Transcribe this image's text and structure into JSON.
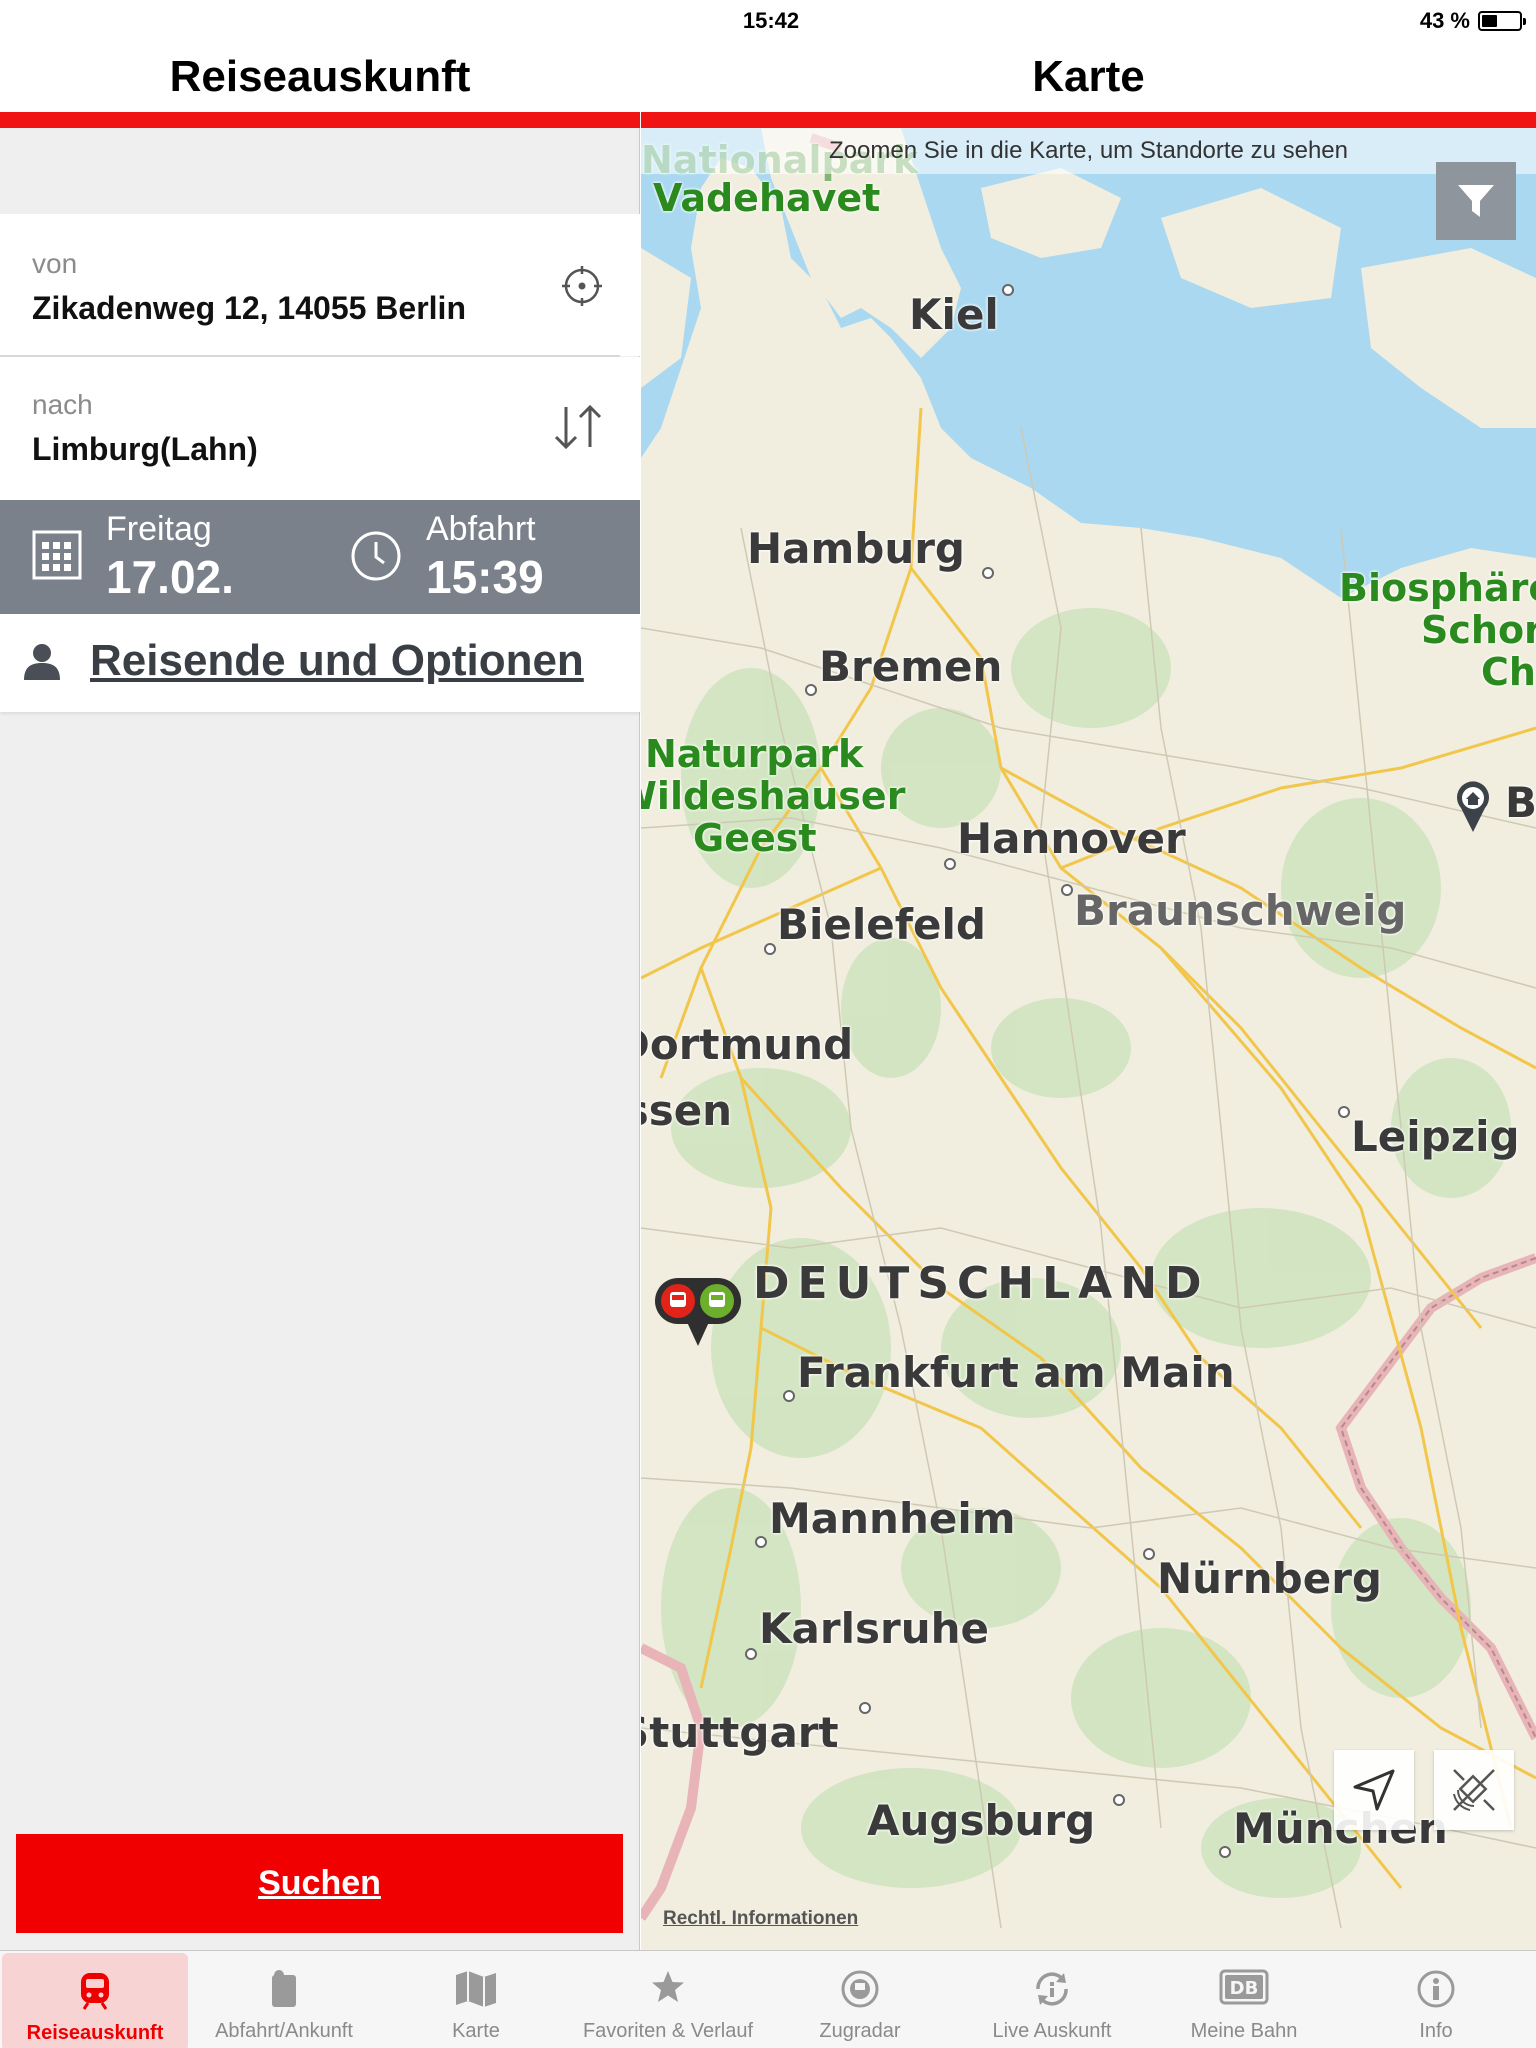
{
  "status": {
    "device": "iPad",
    "time": "15:42",
    "battery": "43 %",
    "battery_level": 0.43
  },
  "left": {
    "title": "Reiseauskunft",
    "from": {
      "label": "von",
      "value": "Zikadenweg 12, 14055 Berlin"
    },
    "to": {
      "label": "nach",
      "value": "Limburg(Lahn)"
    },
    "date": {
      "day": "Freitag",
      "value": "17.02."
    },
    "time": {
      "label": "Abfahrt",
      "value": "15:39"
    },
    "options": "Reisende und Optionen",
    "search": "Suchen"
  },
  "right": {
    "title": "Karte",
    "hint": "Zoomen Sie in die Karte, um Standorte zu sehen",
    "legal": "Rechtl. Informationen",
    "labels": {
      "nationalpark": "Nationalpark",
      "vadehavet": "Vadehavet",
      "kiel": "Kiel",
      "hamburg": "Hamburg",
      "bremen": "Bremen",
      "naturpark1": "Naturpark",
      "naturpark2": "Wildeshauser",
      "naturpark3": "Geest",
      "hannover": "Hannover",
      "braunschweig": "Braunschweig",
      "bielefeld": "Bielefeld",
      "dortmund": "Dortmund",
      "essen": "Essen",
      "leipzig": "Leipzig",
      "deutschland": "DEUTSCHLAND",
      "frankfurt": "Frankfurt am Main",
      "mannheim": "Mannheim",
      "nuernberg": "Nürnberg",
      "karlsruhe": "Karlsruhe",
      "stuttgart": "Stuttgart",
      "augsburg": "Augsburg",
      "muenchen": "München",
      "bio1": "Biosphäre",
      "bio2": "Schor",
      "bio3": "Ch",
      "berlin": "B"
    }
  },
  "tabs": [
    {
      "label": "Reiseauskunft",
      "icon": "train-icon",
      "active": true
    },
    {
      "label": "Abfahrt/Ankunft",
      "icon": "departure-board-icon",
      "active": false
    },
    {
      "label": "Karte",
      "icon": "map-icon",
      "active": false
    },
    {
      "label": "Favoriten & Verlauf",
      "icon": "star-icon",
      "active": false
    },
    {
      "label": "Zugradar",
      "icon": "radar-icon",
      "active": false
    },
    {
      "label": "Live Auskunft",
      "icon": "live-info-icon",
      "active": false
    },
    {
      "label": "Meine Bahn",
      "icon": "db-logo-icon",
      "active": false
    },
    {
      "label": "Info",
      "icon": "info-icon",
      "active": false
    }
  ],
  "colors": {
    "db_red": "#f01414",
    "date_bar": "#7b818b",
    "tab_active": "#e00000",
    "map_water": "#a9d8f0",
    "map_land": "#f1eedf",
    "map_forest": "#cfe3bf"
  }
}
